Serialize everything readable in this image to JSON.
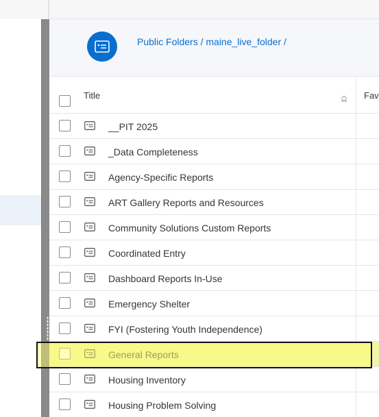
{
  "breadcrumb": {
    "text": "Public Folders / maine_live_folder /"
  },
  "header_icon": "folder-icon",
  "table": {
    "columns": [
      "Title",
      "Fav"
    ],
    "rows": [
      {
        "title": "__PIT 2025"
      },
      {
        "title": "_Data Completeness"
      },
      {
        "title": "Agency-Specific Reports"
      },
      {
        "title": "ART Gallery Reports and Resources"
      },
      {
        "title": "Community Solutions Custom Reports"
      },
      {
        "title": "Coordinated Entry"
      },
      {
        "title": "Dashboard Reports In-Use"
      },
      {
        "title": "Emergency Shelter"
      },
      {
        "title": "FYI (Fostering Youth Independence)"
      },
      {
        "title": "General Reports",
        "highlighted": true
      },
      {
        "title": "Housing Inventory"
      },
      {
        "title": "Housing Problem Solving"
      }
    ]
  },
  "colors": {
    "accent": "#0a6ed1",
    "highlight": "#f2f5a8",
    "splitter": "#8a8a8a"
  }
}
